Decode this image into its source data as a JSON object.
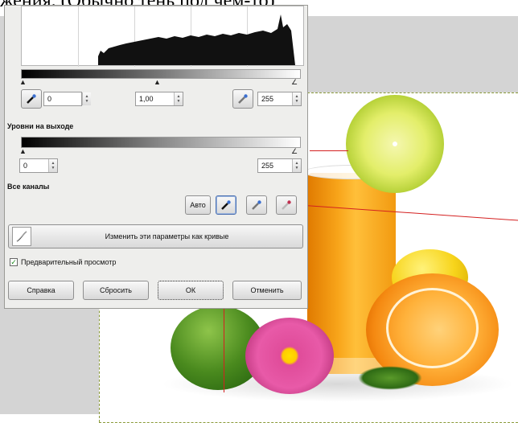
{
  "caption": {
    "text": "жения. (Обычно тень под чем-то)"
  },
  "levels_dialog": {
    "input": {
      "black_value": "0",
      "gamma_value": "1,00",
      "white_value": "255"
    },
    "output_section_label": "Уровни на выходе",
    "output": {
      "black_value": "0",
      "white_value": "255"
    },
    "all_channels_label": "Все каналы",
    "auto_button": "Авто",
    "curves_button": "Изменить эти параметры как кривые",
    "preview_label": "Предварительный просмотр",
    "preview_checked": true,
    "buttons": {
      "help": "Справка",
      "reset": "Сбросить",
      "ok": "ОК",
      "cancel": "Отменить"
    }
  },
  "colors": {
    "dialog_bg": "#eeeeec",
    "guide_line": "#d42020",
    "selection_dash": "#8a9a3a"
  },
  "icons": [
    "eyedropper-black-icon",
    "eyedropper-gray-icon",
    "eyedropper-white-icon",
    "curves-icon",
    "spin-arrows-icon"
  ]
}
